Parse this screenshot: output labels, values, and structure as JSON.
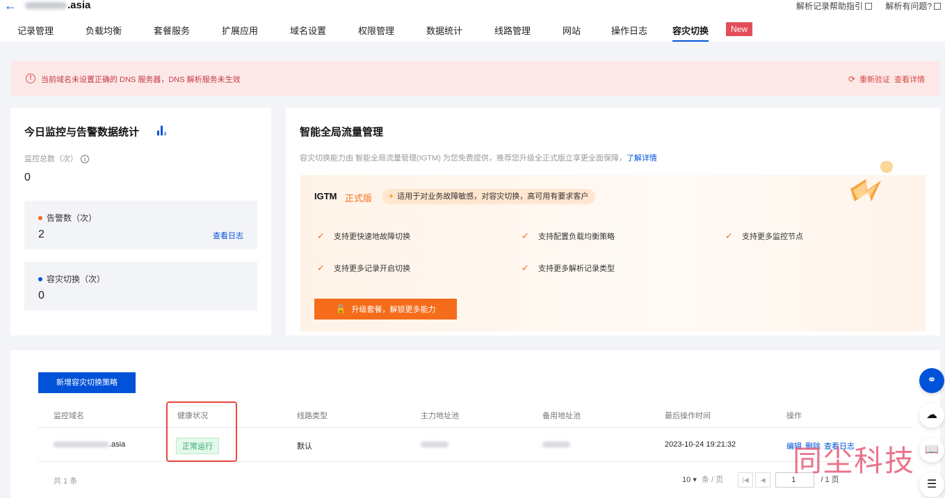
{
  "header": {
    "back_icon": "back-arrow-icon",
    "domain_suffix": ".asia",
    "help_guide": "解析记录帮助指引",
    "help_question": "解析有问题?"
  },
  "tabs": [
    {
      "label": "记录管理"
    },
    {
      "label": "负载均衡"
    },
    {
      "label": "套餐服务"
    },
    {
      "label": "扩展应用"
    },
    {
      "label": "域名设置"
    },
    {
      "label": "权限管理"
    },
    {
      "label": "数据统计"
    },
    {
      "label": "线路管理"
    },
    {
      "label": "网站"
    },
    {
      "label": "操作日志"
    },
    {
      "label": "容灾切换",
      "active": true
    }
  ],
  "new_badge": "New",
  "alert": {
    "text": "当前域名未设置正确的 DNS 服务器，DNS 解析服务未生效",
    "revalidate": "重新验证",
    "details": "查看详情"
  },
  "stats": {
    "title": "今日监控与告警数据统计",
    "monitor_label": "监控总数（次）",
    "monitor_value": "0",
    "alerts": {
      "label": "告警数（次）",
      "value": "2",
      "link": "查看日志",
      "color": "#f56c1a"
    },
    "failover": {
      "label": "容灾切换（次）",
      "value": "0",
      "color": "#0052d9"
    }
  },
  "igtm": {
    "title": "智能全局流量管理",
    "desc": "容灾切换能力由 智能全局流量管理(IGTM) 为您免费提供，推荐您升级全正式版立享更全面保障，",
    "desc_link": "了解详情",
    "product": "IGTM",
    "edition": "正式版",
    "tag": "适用于对业务故障敏感，对容灾切换，高可用有要求客户",
    "features": [
      "支持更快速地故障切换",
      "支持配置负载均衡策略",
      "支持更多监控节点",
      "支持更多记录开启切换",
      "支持更多解析记录类型"
    ],
    "upgrade_button": "升级套餐，解锁更多能力"
  },
  "policy_table": {
    "add_button": "新增容灾切换策略",
    "columns": [
      "监控域名",
      "健康状况",
      "线路类型",
      "主力地址池",
      "备用地址池",
      "最后操作时间",
      "操作"
    ],
    "rows": [
      {
        "domain_suffix": ".asia",
        "health": "正常运行",
        "line_type": "默认",
        "last_op_time": "2023-10-24 19:21:32",
        "actions": [
          "编辑",
          "删除",
          "查看日志"
        ]
      }
    ],
    "total": "共 1 条",
    "page_size": "10",
    "page_size_unit": "条 / 页",
    "current_page": "1",
    "total_pages": "/ 1 页"
  },
  "watermark": "同尘科技",
  "colors": {
    "accent": "#0052d9",
    "orange": "#f56c1a",
    "danger": "#e34d59",
    "success": "#2ba471"
  }
}
